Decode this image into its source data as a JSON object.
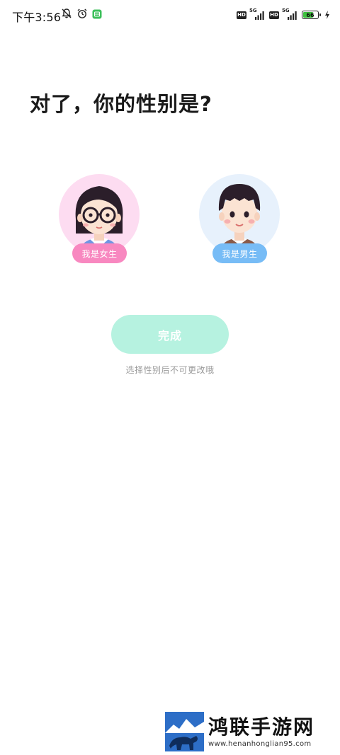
{
  "status_bar": {
    "time": "下午3:56",
    "left_icons": [
      "mute-bell-icon",
      "alarm-icon",
      "app-notification-icon"
    ],
    "network_badges": [
      "HD",
      "HD"
    ],
    "network_type": "5G",
    "battery_percent": "66",
    "charging": true
  },
  "main": {
    "title": "对了，你的性别是?",
    "options": [
      {
        "label": "我是女生",
        "color": "#f888c0",
        "bg": "#fddcf1"
      },
      {
        "label": "我是男生",
        "color": "#77bcf6",
        "bg": "#e7f1fc"
      }
    ],
    "done_button": "完成",
    "hint": "选择性别后不可更改哦"
  },
  "watermark": {
    "title": "鸿联手游网",
    "url": "www.henanhonglian95.com"
  },
  "colors": {
    "accent": "#b6f2e0",
    "female": "#f888c0",
    "male": "#77bcf6",
    "watermark_blue": "#2d6ec7"
  }
}
